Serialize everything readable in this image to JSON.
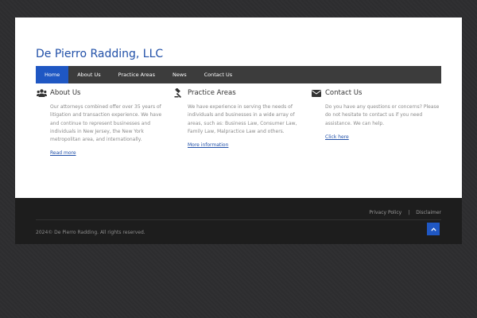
{
  "site": {
    "title": "De Pierro Radding, LLC"
  },
  "nav": {
    "items": [
      {
        "label": "Home"
      },
      {
        "label": "About Us"
      },
      {
        "label": "Practice Areas"
      },
      {
        "label": "News"
      },
      {
        "label": "Contact Us"
      }
    ],
    "active_color": "#1f57c3"
  },
  "columns": [
    {
      "icon": "users-icon",
      "title": "About Us",
      "text": "Our attorneys combined offer over 35 years of litigation and transaction experience. We have and continue to represent businesses and individuals in New Jersey, the New York metropolitan area, and internationally.",
      "link": "Read more"
    },
    {
      "icon": "gavel-icon",
      "title": "Practice Areas",
      "text": "We have experience in serving the needs of individuals and businesses in a wide array of areas, such as: Business Law, Consumer Law, Family Law, Malpractice Law and others.",
      "link": "More information"
    },
    {
      "icon": "envelope-icon",
      "title": "Contact Us",
      "text": "Do you have any questions or concerns? Please do not hesitate to contact us if you need assistance. We can help.",
      "link": "Click here"
    }
  ],
  "footer": {
    "links": [
      {
        "label": "Privacy Policy"
      },
      {
        "label": "Disclaimer"
      }
    ],
    "separator": "|",
    "copyright": "2024© De Pierro Radding. All rights reserved.",
    "to_top_icon": "chevron-up-icon"
  },
  "colors": {
    "brand": "#2150a8",
    "nav_bg": "#3c3c3c",
    "footer_bg": "#1d1d1d"
  }
}
